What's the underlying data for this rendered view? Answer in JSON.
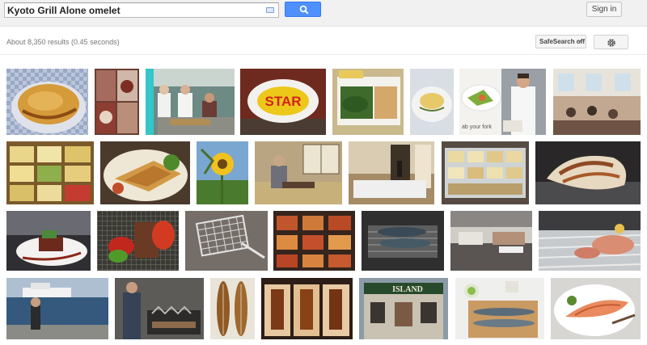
{
  "search": {
    "query": "Kyoto Grill Alone omelet"
  },
  "header": {
    "signin_label": "Sign in"
  },
  "results": {
    "stats": "About 8,350 results (0.45 seconds)",
    "safesearch_label": "SafeSearch off"
  },
  "images": [
    {
      "alt": "omelet rice on blue plate",
      "row": 1
    },
    {
      "alt": "bento set collage",
      "row": 1
    },
    {
      "alt": "cafeteria kitchen",
      "row": 1
    },
    {
      "alt": "omelet with STAR ketchup",
      "row": 1,
      "caption": "STAR"
    },
    {
      "alt": "bento box with greens",
      "row": 1
    },
    {
      "alt": "omelet on plate",
      "row": 1
    },
    {
      "alt": "dish with greens",
      "row": 1,
      "caption": "ab your fork"
    },
    {
      "alt": "chef plating",
      "row": 1
    },
    {
      "alt": "restaurant dining room",
      "row": 1
    },
    {
      "alt": "boxed lunches",
      "row": 2
    },
    {
      "alt": "omelet with salad",
      "row": 2
    },
    {
      "alt": "sunflower",
      "row": 2
    },
    {
      "alt": "man at tatami room",
      "row": 2
    },
    {
      "alt": "traditional japanese room",
      "row": 2
    },
    {
      "alt": "food display case",
      "row": 2
    },
    {
      "alt": "omelet on grill",
      "row": 2
    },
    {
      "alt": "plated steak dessert",
      "row": 3
    },
    {
      "alt": "grilled vegetables",
      "row": 3
    },
    {
      "alt": "wire grill rack",
      "row": 3
    },
    {
      "alt": "bento display",
      "row": 3
    },
    {
      "alt": "fish on grill",
      "row": 3
    },
    {
      "alt": "kitchen counter",
      "row": 3
    },
    {
      "alt": "sliced meat on ice",
      "row": 3
    },
    {
      "alt": "ferry at sea",
      "row": 4
    },
    {
      "alt": "man grilling fish",
      "row": 4
    },
    {
      "alt": "grilled saury fish",
      "row": 4
    },
    {
      "alt": "grilled eel boxes",
      "row": 4
    },
    {
      "alt": "storefront Lilly Island",
      "row": 4,
      "caption": "ISLAND"
    },
    {
      "alt": "fish on wooden board",
      "row": 4
    },
    {
      "alt": "salmon dish",
      "row": 4
    }
  ]
}
